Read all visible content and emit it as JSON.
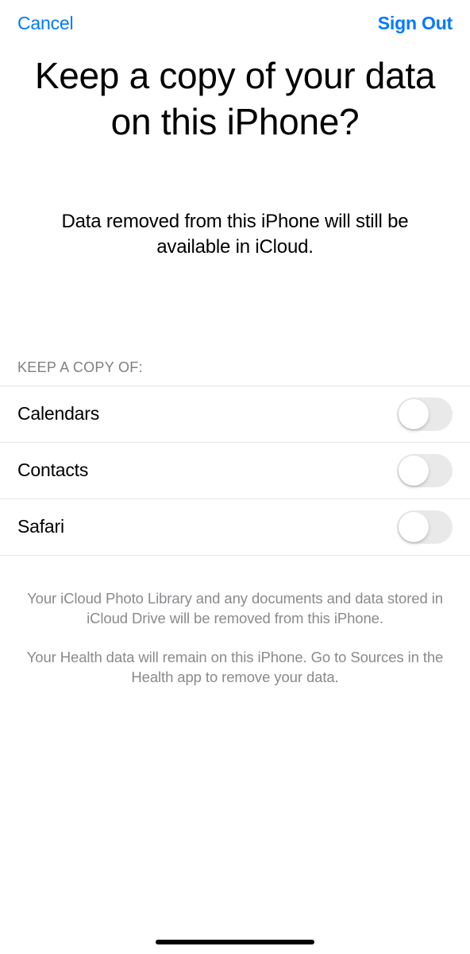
{
  "nav": {
    "cancel": "Cancel",
    "signout": "Sign Out"
  },
  "title": "Keep a copy of your data on this iPhone?",
  "subtitle": "Data removed from this iPhone will still be available in iCloud.",
  "section_header": "KEEP A COPY OF:",
  "items": [
    {
      "label": "Calendars",
      "on": false
    },
    {
      "label": "Contacts",
      "on": false
    },
    {
      "label": "Safari",
      "on": false
    }
  ],
  "footer": {
    "line1": "Your iCloud Photo Library and any documents and data stored in iCloud Drive will be removed from this iPhone.",
    "line2": "Your Health data will remain on this iPhone. Go to Sources in the Health app to remove your data."
  }
}
